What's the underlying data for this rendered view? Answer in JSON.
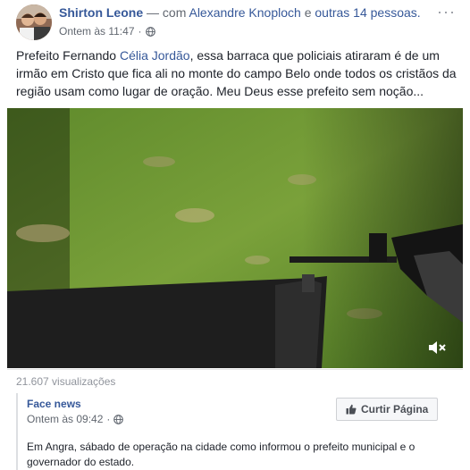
{
  "post": {
    "author": "Shirton Leone",
    "conjunction": "— com",
    "tagged_person": "Alexandre Knoploch",
    "tagged_joiner": "e",
    "tagged_others": "outras 14 pessoas.",
    "timestamp": "Ontem às 11:47",
    "privacy_icon": "globe-icon",
    "menu_label": "···",
    "text_before": "Prefeito Fernando ",
    "text_mention": "Célia Jordão",
    "text_after": ", essa barraca que policiais atiraram é de um irmão em Cristo que fica ali no monte do campo Belo onde todos os cristãos da região usam como lugar de oração. Meu Deus esse prefeito sem noção..."
  },
  "video": {
    "mute_icon": "muted-speaker-icon",
    "views": "21.607 visualizações"
  },
  "shared": {
    "page_name": "Face news",
    "timestamp": "Ontem às 09:42",
    "privacy_icon": "globe-icon",
    "like_button": "Curtir Página",
    "like_icon": "thumbs-up-icon",
    "text": "Em Angra, sábado de operação na cidade como informou o prefeito municipal e o governador do estado."
  },
  "colors": {
    "link": "#365899",
    "text": "#1d2129",
    "muted": "#616770"
  }
}
